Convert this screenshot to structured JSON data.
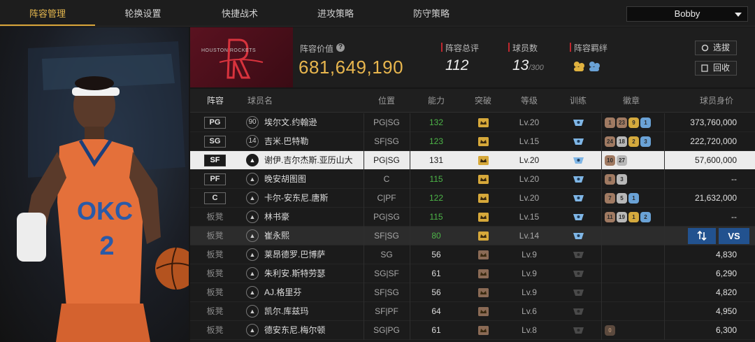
{
  "tabs": [
    {
      "label": "阵容管理",
      "active": true
    },
    {
      "label": "轮换设置",
      "active": false
    },
    {
      "label": "快捷战术",
      "active": false
    },
    {
      "label": "进攻策略",
      "active": false
    },
    {
      "label": "防守策略",
      "active": false
    }
  ],
  "user": {
    "selected": "Bobby"
  },
  "team": {
    "logo_text": "HOUSTON ROCKETS",
    "value_label": "阵容价值",
    "value": "681,649,190",
    "rating_label": "阵容总评",
    "rating": "112",
    "players_label": "球员数",
    "players_count": "13",
    "players_max": "/300",
    "bond_label": "阵容羁绊",
    "btn_select": "选拔",
    "btn_recycle": "回收"
  },
  "portrait": {
    "jersey_text": "OKC",
    "jersey_number": "2"
  },
  "columns": [
    "阵容",
    "球员名",
    "位置",
    "能力",
    "突破",
    "等级",
    "训练",
    "徽章",
    "球员身价"
  ],
  "rows": [
    {
      "slot": "PG",
      "num": "90",
      "name": "埃尔文.约翰逊",
      "pos": "PG|SG",
      "ability": "132",
      "ability_color": "green",
      "level": "Lv.20",
      "train": true,
      "badges": [
        {
          "t": "b",
          "v": "1"
        },
        {
          "t": "b",
          "v": "23"
        },
        {
          "t": "g",
          "v": "9"
        },
        {
          "t": "bl",
          "v": "1"
        }
      ],
      "price": "373,760,000"
    },
    {
      "slot": "SG",
      "num": "14",
      "name": "吉米.巴特勒",
      "pos": "SF|SG",
      "ability": "123",
      "ability_color": "green",
      "level": "Lv.15",
      "train": true,
      "badges": [
        {
          "t": "b",
          "v": "24"
        },
        {
          "t": "s",
          "v": "18"
        },
        {
          "t": "g",
          "v": "2"
        },
        {
          "t": "bl",
          "v": "3"
        }
      ],
      "price": "222,720,000"
    },
    {
      "slot": "SF",
      "num": "",
      "name": "谢伊.吉尔杰斯.亚历山大",
      "pos": "PG|SG",
      "ability": "131",
      "ability_color": "dark",
      "level": "Lv.20",
      "train": true,
      "badges": [
        {
          "t": "b",
          "v": "10"
        },
        {
          "t": "s",
          "v": "27"
        }
      ],
      "price": "57,600,000",
      "selected": true
    },
    {
      "slot": "PF",
      "num": "",
      "name": "晚安胡图图",
      "pos": "C",
      "ability": "115",
      "ability_color": "green",
      "level": "Lv.20",
      "train": true,
      "badges": [
        {
          "t": "b",
          "v": "8"
        },
        {
          "t": "s",
          "v": "3"
        }
      ],
      "price": "--"
    },
    {
      "slot": "C",
      "num": "",
      "name": "卡尔-安东尼.唐斯",
      "pos": "C|PF",
      "ability": "122",
      "ability_color": "green",
      "level": "Lv.20",
      "train": true,
      "badges": [
        {
          "t": "b",
          "v": "7"
        },
        {
          "t": "s",
          "v": "5"
        },
        {
          "t": "bl",
          "v": "1"
        }
      ],
      "price": "21,632,000"
    },
    {
      "slot": "板凳",
      "num": "",
      "name": "林书豪",
      "pos": "PG|SG",
      "ability": "115",
      "ability_color": "green",
      "level": "Lv.15",
      "train": true,
      "badges": [
        {
          "t": "b",
          "v": "11"
        },
        {
          "t": "s",
          "v": "19"
        },
        {
          "t": "g",
          "v": "1"
        },
        {
          "t": "bl",
          "v": "2"
        }
      ],
      "price": "--",
      "bench": true
    },
    {
      "slot": "板凳",
      "num": "",
      "name": "崔永熙",
      "pos": "SF|SG",
      "ability": "80",
      "ability_color": "green",
      "level": "Lv.14",
      "train": true,
      "badges": [],
      "price": "",
      "bench": true,
      "hover": true
    },
    {
      "slot": "板凳",
      "num": "",
      "name": "莱昂德罗.巴博萨",
      "pos": "SG",
      "ability": "56",
      "ability_color": "white",
      "level": "Lv.9",
      "train": false,
      "badges": [],
      "price": "4,830",
      "bench": true,
      "low": true
    },
    {
      "slot": "板凳",
      "num": "",
      "name": "朱利安.斯特劳瑟",
      "pos": "SG|SF",
      "ability": "61",
      "ability_color": "white",
      "level": "Lv.9",
      "train": false,
      "badges": [],
      "price": "6,290",
      "bench": true,
      "low": true
    },
    {
      "slot": "板凳",
      "num": "",
      "name": "AJ.格里芬",
      "pos": "SF|SG",
      "ability": "56",
      "ability_color": "white",
      "level": "Lv.9",
      "train": false,
      "badges": [],
      "price": "4,820",
      "bench": true,
      "low": true
    },
    {
      "slot": "板凳",
      "num": "",
      "name": "凯尔.库兹玛",
      "pos": "SF|PF",
      "ability": "64",
      "ability_color": "white",
      "level": "Lv.6",
      "train": false,
      "badges": [],
      "price": "4,950",
      "bench": true,
      "low": true
    },
    {
      "slot": "板凳",
      "num": "",
      "name": "德安东尼.梅尔顿",
      "pos": "SG|PG",
      "ability": "61",
      "ability_color": "white",
      "level": "Lv.8",
      "train": false,
      "badges": [
        {
          "t": "db",
          "v": "0"
        }
      ],
      "price": "6,300",
      "bench": true,
      "low": true
    }
  ],
  "row_actions": {
    "vs_label": "VS"
  },
  "colors": {
    "accent_gold": "#e8b64e",
    "team_red": "#5a1220",
    "green": "#4db548",
    "action_blue": "#22528f"
  }
}
